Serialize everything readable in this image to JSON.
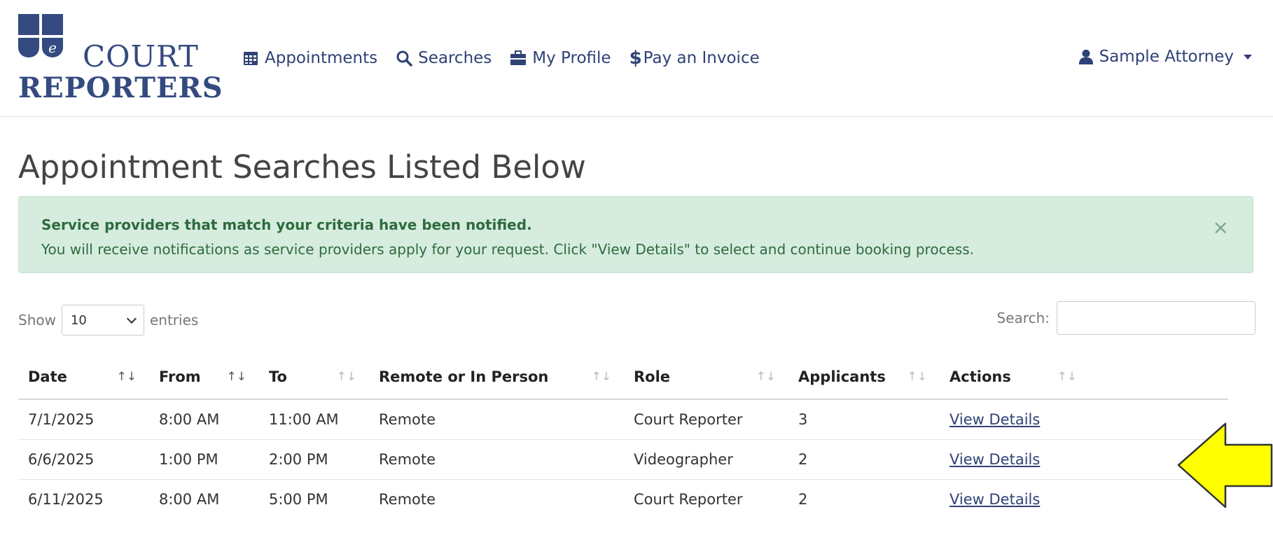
{
  "brand": {
    "name": "eCourt Reporters",
    "logo_letter": "e",
    "logo_court": "Court",
    "logo_reporters": "Reporters"
  },
  "nav": {
    "appointments": "Appointments",
    "searches": "Searches",
    "my_profile": "My Profile",
    "pay_invoice": "Pay an Invoice",
    "user": "Sample Attorney"
  },
  "page": {
    "title": "Appointment Searches Listed Below"
  },
  "alert": {
    "heading": "Service providers that match your criteria have been notified.",
    "body": "You will receive notifications as service providers apply for your request. Click \"View Details\" to select and continue booking process.",
    "close": "×"
  },
  "controls": {
    "show_label": "Show",
    "show_value": "10",
    "entries_label": "entries",
    "search_label": "Search:"
  },
  "table": {
    "headers": [
      "Date",
      "From",
      "To",
      "Remote or In Person",
      "Role",
      "Applicants",
      "Actions"
    ],
    "rows": [
      [
        "7/1/2025",
        "8:00 AM",
        "11:00 AM",
        "Remote",
        "Court Reporter",
        "3",
        "View Details"
      ],
      [
        "6/6/2025",
        "1:00 PM",
        "2:00 PM",
        "Remote",
        "Videographer",
        "2",
        "View Details"
      ],
      [
        "6/11/2025",
        "8:00 AM",
        "5:00 PM",
        "Remote",
        "Court Reporter",
        "2",
        "View Details"
      ]
    ]
  },
  "colors": {
    "brand_navy": "#344a80",
    "link": "#2f4276",
    "alert_bg": "#d6ecdf",
    "alert_text": "#2e6b3d",
    "arrow_fill": "#ffff00"
  },
  "icons": [
    "calendar-icon",
    "search-icon",
    "briefcase-icon",
    "user-icon",
    "close-icon",
    "sort-icon",
    "chevron-down-icon",
    "arrow-left-icon"
  ]
}
